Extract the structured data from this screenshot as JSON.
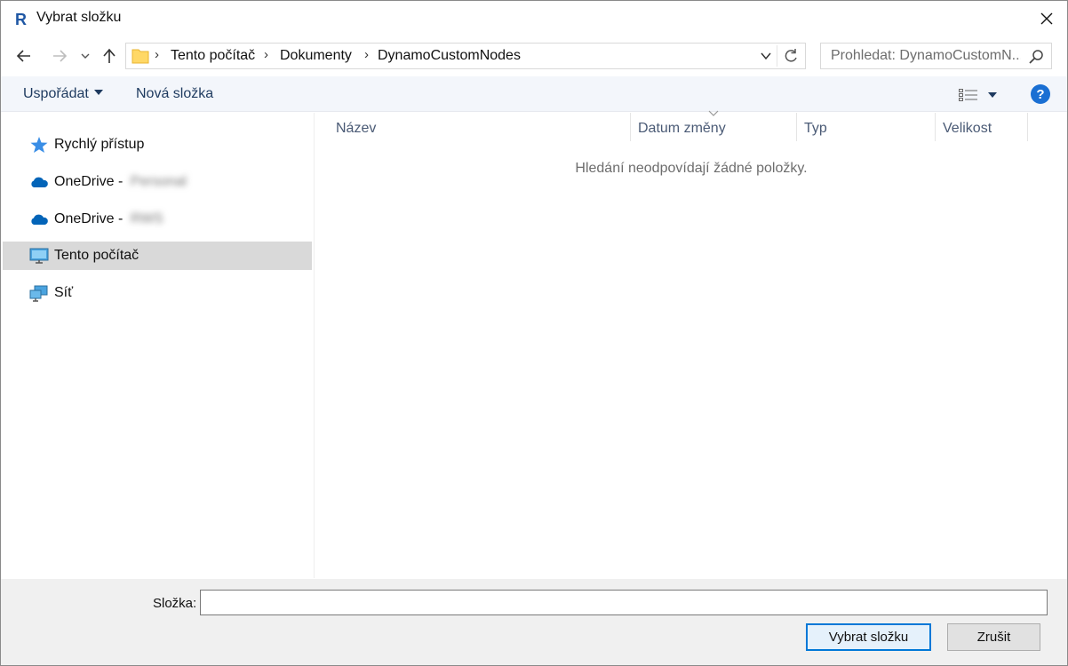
{
  "window": {
    "title": "Vybrat složku",
    "app_icon_letter": "R"
  },
  "nav": {
    "breadcrumbs": [
      "Tento počítač",
      "Dokumenty",
      "DynamoCustomNodes"
    ],
    "search_placeholder": "Prohledat: DynamoCustomN..."
  },
  "commands": {
    "organize": "Uspořádat",
    "new_folder": "Nová složka",
    "help": "?"
  },
  "sidebar": {
    "items": [
      {
        "label": "Rychlý přístup",
        "blurred": "",
        "icon": "star-icon"
      },
      {
        "label": "OneDrive - ",
        "blurred": "Personal",
        "icon": "onedrive-cloud-icon"
      },
      {
        "label": "OneDrive - ",
        "blurred": "RWS",
        "icon": "onedrive-cloud-icon"
      },
      {
        "label": "Tento počítač",
        "blurred": "",
        "icon": "computer-icon",
        "selected": true
      },
      {
        "label": "Síť",
        "blurred": "",
        "icon": "network-icon"
      }
    ]
  },
  "columns": [
    "Název",
    "Datum změny",
    "Typ",
    "Velikost"
  ],
  "empty_message": "Hledání neodpovídají žádné položky.",
  "footer": {
    "folder_label": "Složka:",
    "folder_value": "",
    "select_button": "Vybrat složku",
    "cancel_button": "Zrušit"
  },
  "colors": {
    "accent": "#0078d7",
    "selection": "#d9d9d9",
    "command_bar": "#f3f6fb",
    "onedrive": "#0364b8"
  }
}
